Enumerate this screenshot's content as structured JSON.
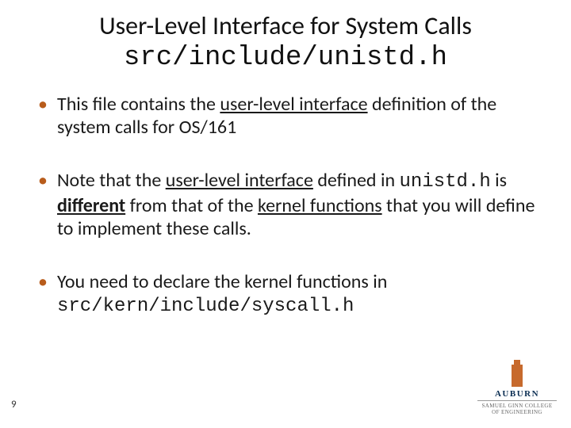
{
  "title": {
    "line1": "User-Level Interface for System Calls",
    "line2_code": "src/include/unistd.h"
  },
  "bullets": [
    {
      "pre": "This file contains the ",
      "u1": "user-level interface",
      "post": " definition of the system calls for OS/161"
    },
    {
      "pre": "Note that the ",
      "u1": "user-level interface",
      "mid1": " defined in ",
      "code1": "unistd.h",
      "mid2": " is ",
      "bu": "different",
      "mid3": " from that of the ",
      "u2": "kernel functions",
      "post": " that you will define to implement these calls."
    },
    {
      "pre": "You need to declare the kernel functions in ",
      "code1": "src/kern/include/syscall.h"
    }
  ],
  "page_number": "9",
  "logo": {
    "name": "AUBURN",
    "sub": "SAMUEL GINN COLLEGE OF ENGINEERING"
  }
}
